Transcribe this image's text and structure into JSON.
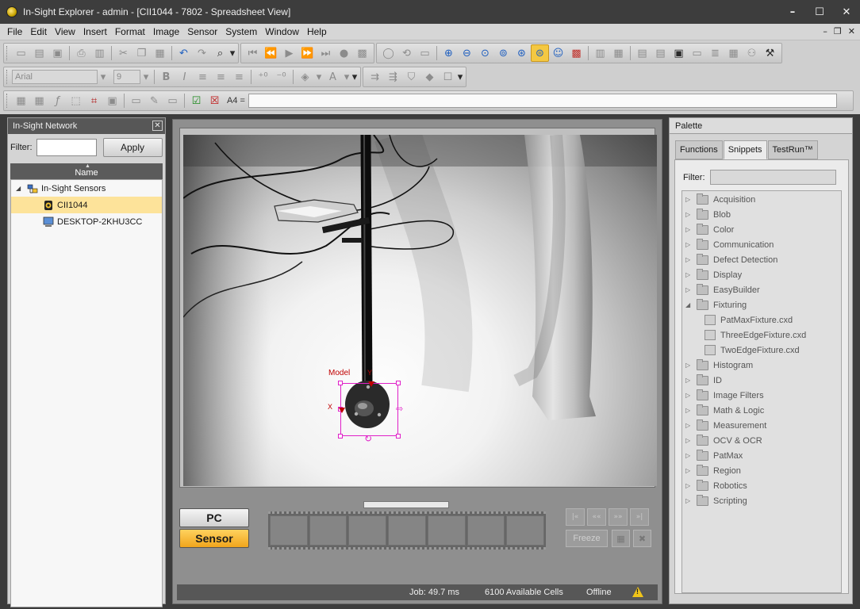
{
  "window": {
    "title": "In-Sight Explorer - admin - [CII1044 - 7802 - Spreadsheet View]",
    "controls": [
      "–",
      "☐",
      "✕"
    ],
    "mdi_controls": [
      "–",
      "❐",
      "✕"
    ]
  },
  "menu": [
    "File",
    "Edit",
    "View",
    "Insert",
    "Format",
    "Image",
    "Sensor",
    "System",
    "Window",
    "Help"
  ],
  "toolbar": {
    "font_name": "Arial",
    "font_size": "9",
    "cell_ref": "A4 =",
    "formula_value": ""
  },
  "network": {
    "title": "In-Sight Network",
    "close": "✕",
    "filter_label": "Filter:",
    "filter_value": "",
    "apply_label": "Apply",
    "column_header": "Name",
    "sort_glyph": "▲",
    "root_toggle": "◢",
    "root": "In-Sight Sensors",
    "items": [
      "CII1044",
      "DESKTOP-2KHU3CC"
    ]
  },
  "image": {
    "model_label": "Model",
    "x_label": "X",
    "y_label": "Y"
  },
  "controls": {
    "pc_label": "PC",
    "sensor_label": "Sensor",
    "playback": [
      "|«",
      "««",
      "»»",
      "»|"
    ],
    "freeze_label": "Freeze"
  },
  "status": {
    "job": "Job: 49.7 ms",
    "cells": "6100 Available Cells",
    "state": "Offline",
    "warning": "!"
  },
  "palette": {
    "title": "Palette",
    "tabs": [
      "Functions",
      "Snippets",
      "TestRun™"
    ],
    "active_tab": "Snippets",
    "filter_label": "Filter:",
    "filter_value": "",
    "collapsed_glyph": "▷",
    "expanded_glyph": "◢",
    "folders_before": [
      "Acquisition",
      "Blob",
      "Color",
      "Communication",
      "Defect Detection",
      "Display",
      "EasyBuilder"
    ],
    "expanded_folder": "Fixturing",
    "files": [
      "PatMaxFixture.cxd",
      "ThreeEdgeFixture.cxd",
      "TwoEdgeFixture.cxd"
    ],
    "folders_after": [
      "Histogram",
      "ID",
      "Image Filters",
      "Math & Logic",
      "Measurement",
      "OCV & OCR",
      "PatMax",
      "Region",
      "Robotics",
      "Scripting"
    ]
  },
  "colors": {
    "accent": "#f4c842",
    "selection": "#fde39a",
    "roi": "#e020c8",
    "model_text": "#c00000"
  }
}
